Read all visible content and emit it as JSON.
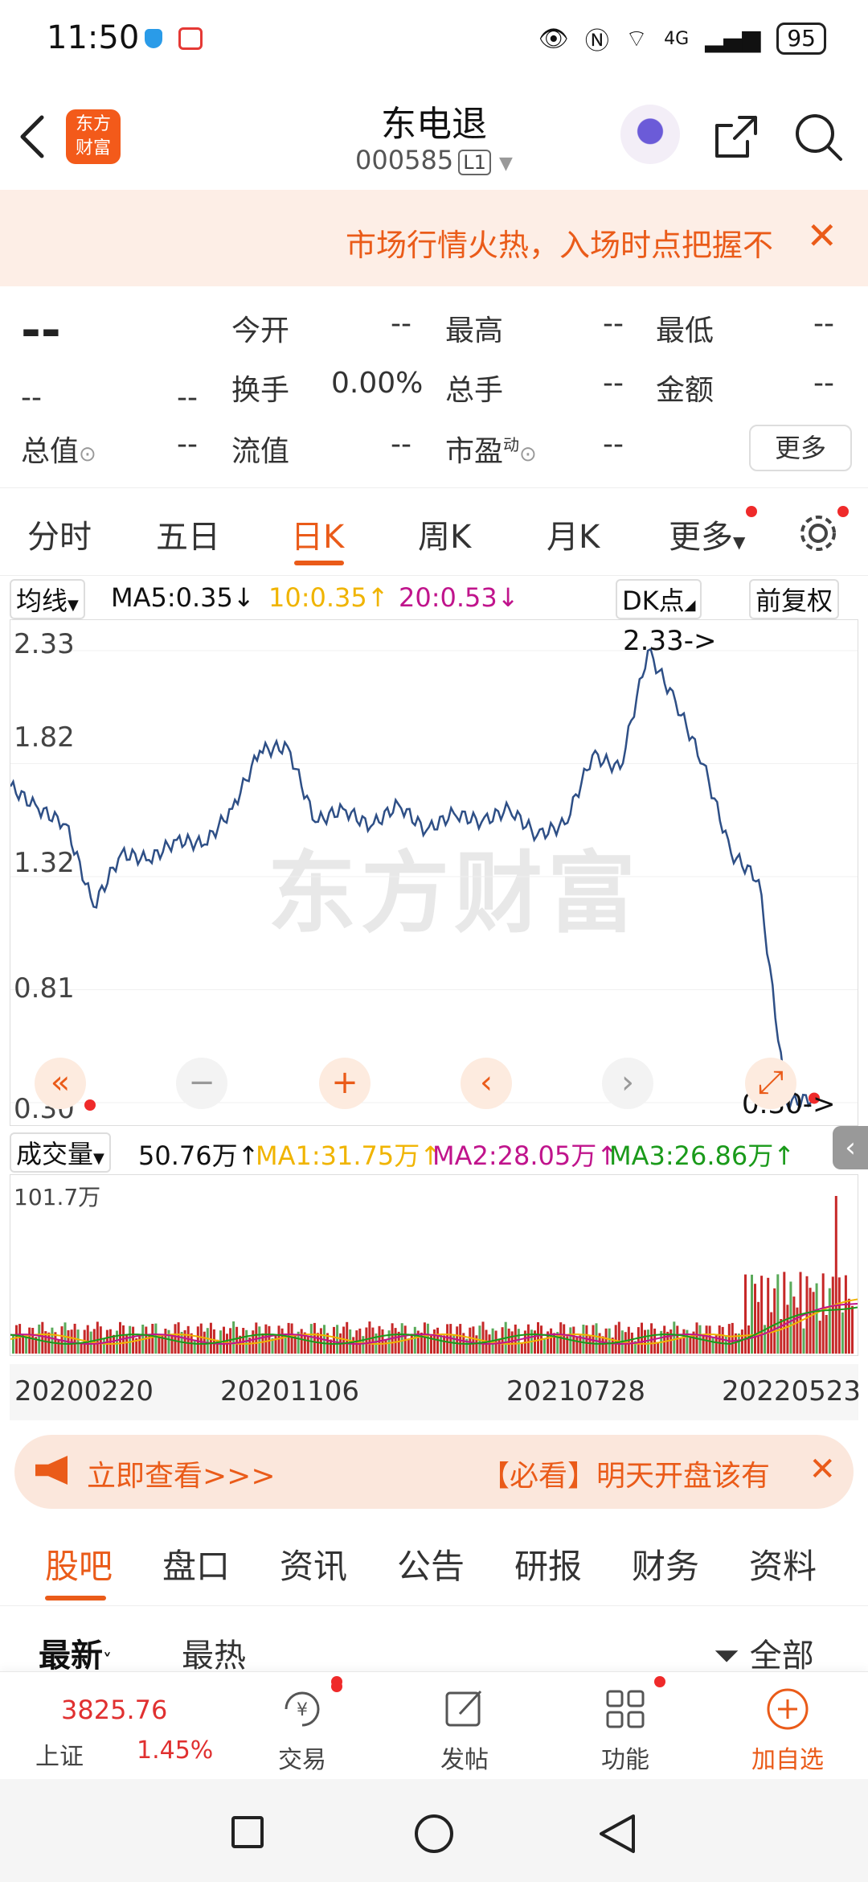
{
  "status_bar": {
    "time": "11:50",
    "battery": "95",
    "network": "4G"
  },
  "header": {
    "logo_text": [
      "东方",
      "财富"
    ],
    "title": "东电退",
    "code": "000585",
    "level": "L1"
  },
  "banner": {
    "text": "市场行情火热，入场时点把握不"
  },
  "quote": {
    "price": "--",
    "change": "--",
    "change_pct": "--",
    "rows": [
      [
        {
          "label": "今开",
          "value": "--"
        },
        {
          "label": "最高",
          "value": "--"
        },
        {
          "label": "最低",
          "value": "--"
        }
      ],
      [
        {
          "label": "换手",
          "value": "0.00%"
        },
        {
          "label": "总手",
          "value": "--"
        },
        {
          "label": "金额",
          "value": "--"
        }
      ],
      [
        {
          "label": "流值",
          "value": "--"
        },
        {
          "label": "市盈",
          "value": "--"
        }
      ]
    ],
    "total_value_label": "总值",
    "total_value": "--",
    "pe_superscript": "动",
    "more": "更多"
  },
  "kline_tabs": [
    "分时",
    "五日",
    "日K",
    "周K",
    "月K",
    "更多"
  ],
  "active_tab": "日K",
  "ma": {
    "label": "均线",
    "ma5": "MA5:0.35",
    "ma10": "10:0.35",
    "ma20": "20:0.53",
    "dk": "DK点",
    "adjust": "前复权"
  },
  "chart": {
    "y_labels": [
      "2.33",
      "1.82",
      "1.32",
      "0.81",
      "0.30"
    ],
    "high_label": "2.33->",
    "low_label": "0.30->",
    "watermark": "东方财富",
    "colors": {
      "line": "#2e4f86",
      "accent": "#ea5b19"
    }
  },
  "volume": {
    "label": "成交量",
    "value": "50.76万",
    "ma1": "MA1:31.75万",
    "ma2": "MA2:28.05万",
    "ma3": "MA3:26.86万",
    "max_label": "101.7万"
  },
  "dates": [
    "20200220",
    "20201106",
    "20210728",
    "20220523"
  ],
  "chart_data": {
    "type": "line",
    "title": "",
    "x": [
      "20200220",
      "20201106",
      "20210728",
      "20220523"
    ],
    "ylim": [
      0.3,
      2.33
    ],
    "series": [
      {
        "values": [
          1.72,
          1.62,
          1.55,
          1.18,
          1.42,
          1.39,
          1.48,
          1.46,
          1.62,
          1.88,
          1.9,
          1.56,
          1.62,
          1.54,
          1.64,
          1.52,
          1.6,
          1.56,
          1.62,
          1.5,
          1.55,
          1.86,
          1.8,
          2.33,
          2.1,
          1.82,
          1.42,
          1.3,
          0.3,
          0.32
        ]
      }
    ]
  },
  "notice": {
    "left": "立即查看>>>",
    "right": "【必看】明天开盘该有"
  },
  "bottom_tabs": [
    "股吧",
    "盘口",
    "资讯",
    "公告",
    "研报",
    "财务",
    "资料"
  ],
  "sorts": {
    "latest": "最新",
    "hot": "最热",
    "all": "全部"
  },
  "bottom_nav": {
    "index_value": "3825.76",
    "index_name": "上证",
    "index_change": "1.45%",
    "items": [
      "交易",
      "发帖",
      "功能",
      "加自选"
    ]
  }
}
